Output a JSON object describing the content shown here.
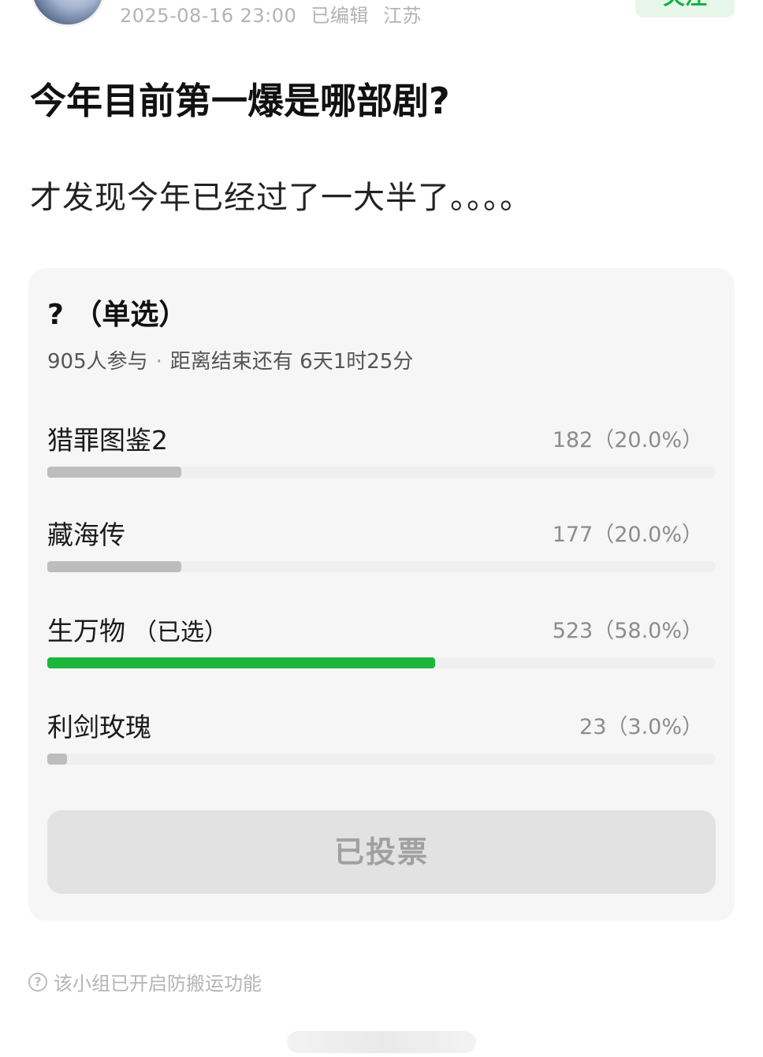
{
  "header": {
    "avatar_icon": "user-avatar",
    "timestamp": "2025-08-16 23:00",
    "edited": "已编辑",
    "location": "江苏",
    "follow_label": "关注"
  },
  "post": {
    "title": "今年目前第一爆是哪部剧?",
    "body": "才发现今年已经过了一大半了。。。。"
  },
  "poll": {
    "title": "? （单选）",
    "participants": "905人参与",
    "separator": "·",
    "time_left": "距离结束还有 6天1时25分",
    "options": [
      {
        "label": "猎罪图鉴2",
        "selected_tag": "",
        "count": "182（20.0%）",
        "percent": 20.0,
        "chosen": false
      },
      {
        "label": "藏海传",
        "selected_tag": "",
        "count": "177（20.0%）",
        "percent": 20.0,
        "chosen": false
      },
      {
        "label": "生万物",
        "selected_tag": "（已选）",
        "count": "523（58.0%）",
        "percent": 58.0,
        "chosen": true
      },
      {
        "label": "利剑玫瑰",
        "selected_tag": "",
        "count": "23（3.0%）",
        "percent": 3.0,
        "chosen": false
      }
    ],
    "vote_button": "已投票"
  },
  "footer": {
    "help_icon": "question-circle-icon",
    "notice": "该小组已开启防搬运功能"
  },
  "colors": {
    "chosen_bar": "#1db63c",
    "other_bar": "#bdbdbd",
    "card_bg": "#f6f6f6"
  }
}
